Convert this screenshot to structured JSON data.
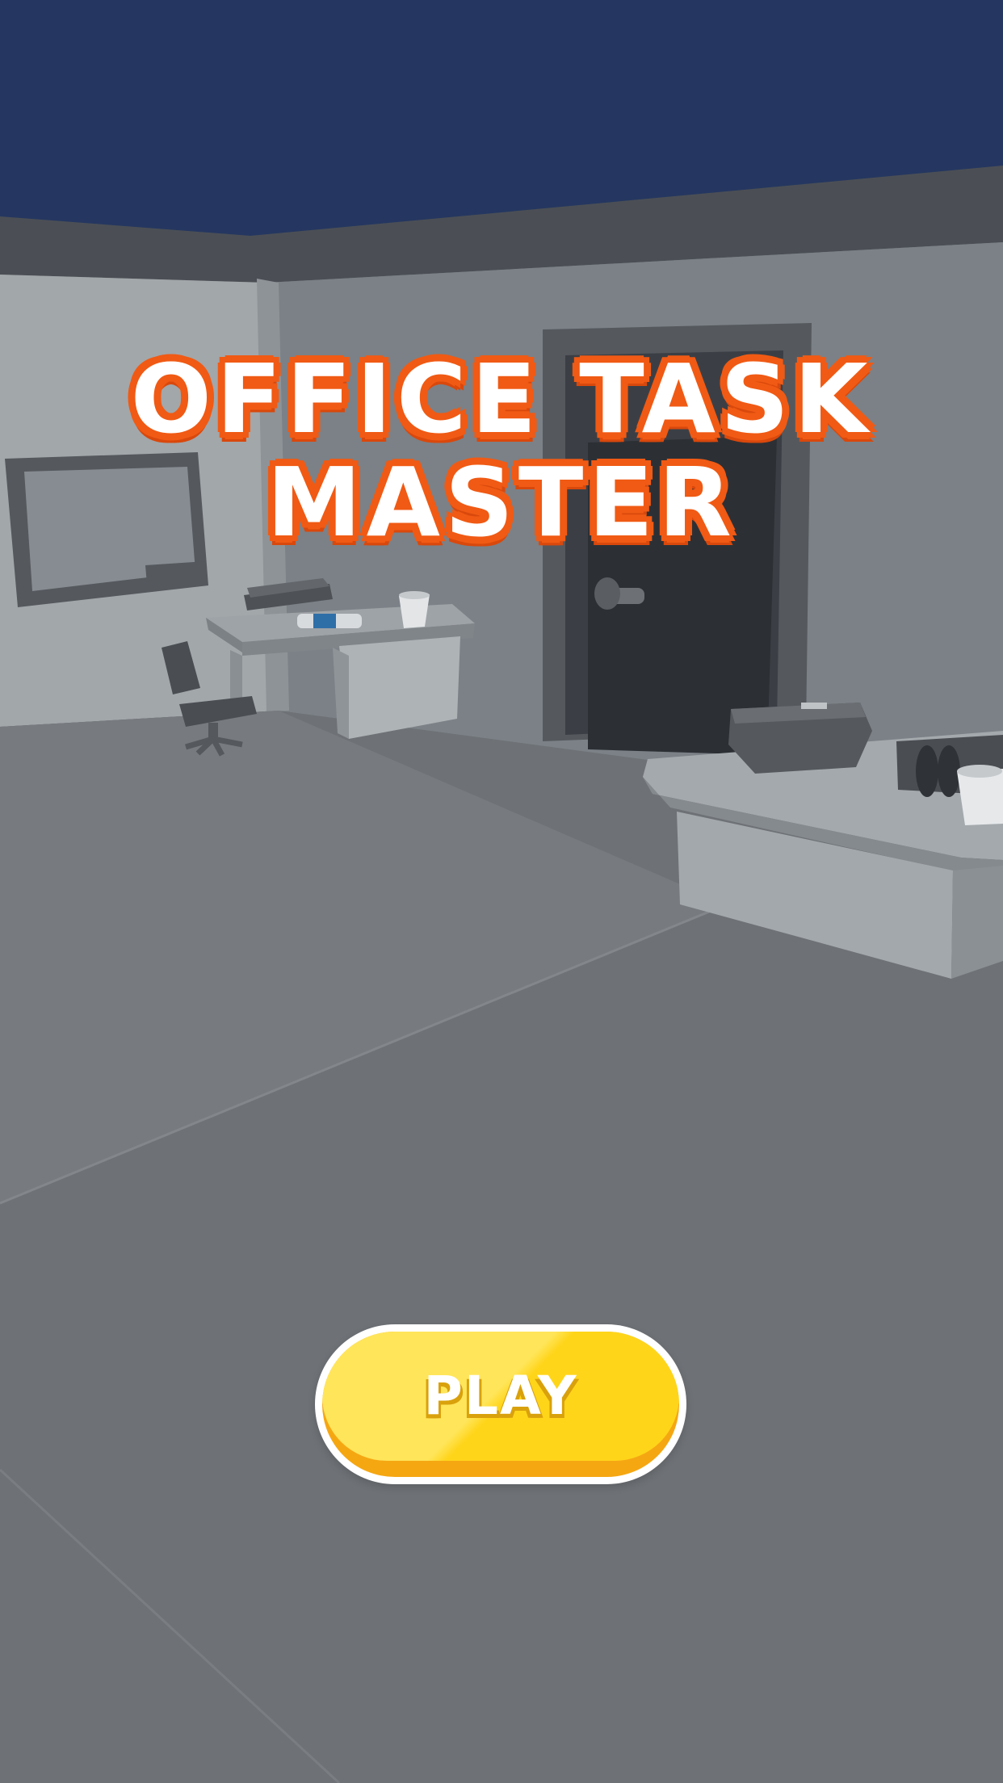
{
  "game": {
    "title_line_1": "OFFICE TASK",
    "title_line_2": "MASTER",
    "play_label": "PLAY"
  },
  "colors": {
    "sky": "#253760",
    "title_fill": "#ffffff",
    "title_outline": "#f05a14",
    "play_button_face": "#ffd51a",
    "play_button_edge": "#f5a712",
    "play_button_rim": "#ffffff",
    "floor": "#6e7276",
    "wall": "#7b8187"
  },
  "scene": {
    "objects": [
      "whiteboard",
      "desk",
      "office-chair",
      "door",
      "desk",
      "binders",
      "cup",
      "book",
      "marker"
    ]
  }
}
